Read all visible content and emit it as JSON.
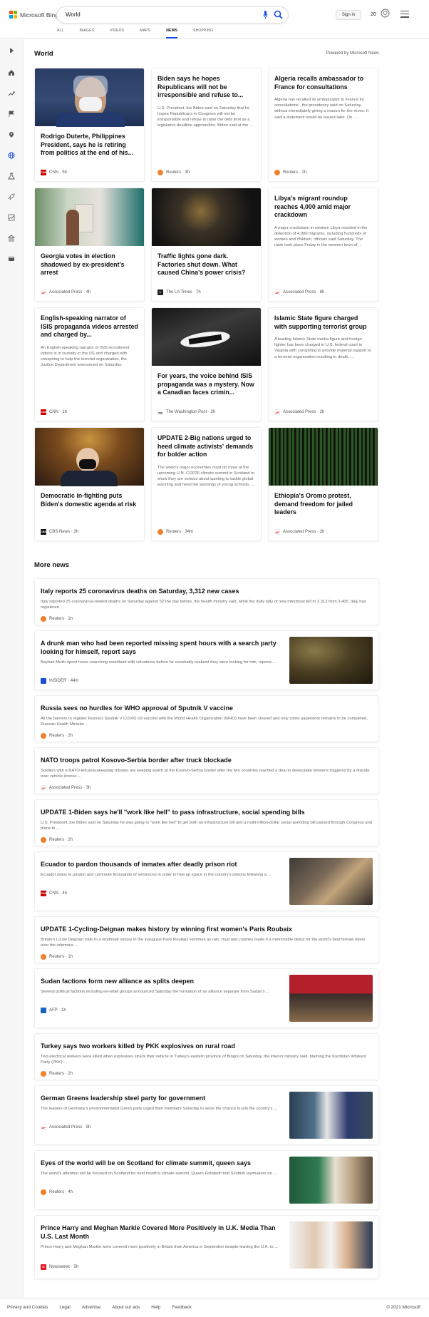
{
  "header": {
    "logo_text": "Microsoft Bing",
    "search_value": "World",
    "sign_in": "Sign in",
    "rewards_count": "20",
    "tabs": [
      "ALL",
      "IMAGES",
      "VIDEOS",
      "MAPS",
      "NEWS",
      "SHOPPING"
    ],
    "active_tab": "NEWS"
  },
  "world": {
    "title": "World",
    "powered_by": "Powered by Microsoft News",
    "cards": [
      {
        "title": "Rodrigo Duterte, Philippines President, says he is retiring from politics at the end of his...",
        "desc": "",
        "source": "CNN",
        "time": "5h"
      },
      {
        "title": "Biden says he hopes Republicans will not be irresponsible and refuse to...",
        "desc": "U.S. President Joe Biden said on Saturday that he hopes Republicans in Congress will not be irresponsible and refuse to raise the debt limit as a legislative deadline approaches. Biden said at the ...",
        "source": "Reuters",
        "time": "3h"
      },
      {
        "title": "Algeria recalls ambassador to France for consultations",
        "desc": "Algeria has recalled its ambassador to France for consultations , the presidency said on Saturday, without immediately giving a reason for the move. It said a statement would be issued later. On ...",
        "source": "Reuters",
        "time": "1h"
      },
      {
        "title": "Georgia votes in election shadowed by ex-president's arrest",
        "desc": "",
        "source": "Associated Press",
        "time": "4h"
      },
      {
        "title": "Traffic lights gone dark. Factories shut down. What caused China's power crisis?",
        "desc": "",
        "source": "The LA Times",
        "time": "7h"
      },
      {
        "title": "Libya's migrant roundup reaches 4,000 amid major crackdown",
        "desc": "A major crackdown in western Libya resulted in the detention of 4,000 migrants, including hundreds of women and children, officials said Saturday. The raids took place Friday in the western town of ...",
        "source": "Associated Press",
        "time": "6h"
      },
      {
        "title": "English-speaking narrator of ISIS propaganda videos arrested and charged by...",
        "desc": "An English-speaking narrator of ISIS recruitment videos is in custody in the US and charged with conspiring to help the terrorist organization, the Justice Department announced on Saturday.",
        "source": "CNN",
        "time": "1h"
      },
      {
        "title": "For years, the voice behind ISIS propaganda was a mystery. Now a Canadian faces crimin...",
        "desc": "",
        "source": "The Washington Post",
        "time": "2h"
      },
      {
        "title": "Islamic State figure charged with supporting terrorist group",
        "desc": "A leading Islamic State media figure and foreign fighter has been charged in U.S. federal court in Virginia with conspiring to provide material support to a terrorist organization resulting in death, ...",
        "source": "Associated Press",
        "time": "2h"
      },
      {
        "title": "Democratic in-fighting puts Biden's domestic agenda at risk",
        "desc": "",
        "source": "CBS News",
        "time": "3h"
      },
      {
        "title": "UPDATE 2-Big nations urged to heed climate activists' demands for bolder action",
        "desc": "The world's major economies must do more at the upcoming U.N. COP26 climate summit in Scotland to show they are serious about wanting to tackle global warming and heed the warnings of young activists, ...",
        "source": "Reuters",
        "time": "34m"
      },
      {
        "title": "Ethiopia's Oromo protest, demand freedom for jailed leaders",
        "desc": "",
        "source": "Associated Press",
        "time": "2h"
      }
    ]
  },
  "more_news": {
    "title": "More news",
    "items": [
      {
        "title": "Italy reports 25 coronavirus deaths on Saturday, 3,312 new cases",
        "desc": "Italy reported 25 coronavirus-related deaths on Saturday against 52 the day before, the health ministry said, while the daily tally of new infections fell to 3,312 from 3,405. Italy has registered ...",
        "source": "Reuters",
        "time": "1h"
      },
      {
        "title": "A drunk man who had been reported missing spent hours with a search party looking for himself, report says",
        "desc": "Beyhan Mutlu spent hours searching woodland with volunteers before he eventually realized they were looking for him, reports ...",
        "source": "INSIDER",
        "time": "44m"
      },
      {
        "title": "Russia sees no hurdles for WHO approval of Sputnik V vaccine",
        "desc": "All the barriers to register Russia's Sputnik V COVID-19 vaccine with the World Health Organization (WHO) have been cleared and only some paperwork remains to be completed, Russian Health Minister ...",
        "source": "Reuters",
        "time": "2h"
      },
      {
        "title": "NATO troops patrol Kosovo-Serbia border after truck blockade",
        "desc": "Soldiers with a NATO-led peacekeeping mission are keeping watch at the Kosovo-Serbia border after the two countries reached a deal to deescalate tensions triggered by a dispute over vehicle license ...",
        "source": "Associated Press",
        "time": "3h"
      },
      {
        "title": "UPDATE 1-Biden says he'll \"work like hell\" to pass infrastructure, social spending bills",
        "desc": "U.S. President Joe Biden said on Saturday he was going to \"work like hell\" to get both an infrastructure bill and a multi-trillion-dollar social spending bill passed through Congress and plans to ...",
        "source": "Reuters",
        "time": "2h"
      },
      {
        "title": "Ecuador to pardon thousands of inmates after deadly prison riot",
        "desc": "Ecuador plans to pardon and commute thousands of sentences in order to free up space in the country's prisons following a ...",
        "source": "CNN",
        "time": "4h"
      },
      {
        "title": "UPDATE 1-Cycling-Deignan makes history by winning first women's Paris Roubaix",
        "desc": "Britain's Lizzie Deignan rode to a landmark victory in the inaugural Paris Roubaix Femmes as rain, mud and crashes made it a memorable debut for the world's best female riders over the infamous ...",
        "source": "Reuters",
        "time": "1h"
      },
      {
        "title": "Sudan factions form new alliance as splits deepen",
        "desc": "Several political factions including ex-rebel groups announced Saturday the formation of an alliance separate from Sudan's ...",
        "source": "AFP",
        "time": "1h"
      },
      {
        "title": "Turkey says two workers killed by PKK explosives on rural road",
        "desc": "Two electrical workers were killed when explosives struck their vehicle in Turkey's eastern province of Bingol on Saturday, the interior ministry said, blaming the Kurdistan Workers' Party (PKK) ...",
        "source": "Reuters",
        "time": "2h"
      },
      {
        "title": "German Greens leadership steel party for government",
        "desc": "The leaders of Germany's environmentalist Green party urged their members Saturday to seize the chance to join the country's ...",
        "source": "Associated Press",
        "time": "5h"
      },
      {
        "title": "Eyes of the world will be on Scotland for climate summit, queen says",
        "desc": "The world's attention will be focused on Scotland for next month's climate summit, Queen Elizabeth told Scottish lawmakers on ...",
        "source": "Reuters",
        "time": "4h"
      },
      {
        "title": "Prince Harry and Meghan Markle Covered More Positively in U.K. Media Than U.S. Last Month",
        "desc": "Prince Harry and Meghan Markle were covered more positively in Britain than America in September despite leaving the U.K. to ...",
        "source": "Newsweek",
        "time": "5h"
      }
    ]
  },
  "footer": {
    "links": [
      "Privacy and Cookies",
      "Legal",
      "Advertise",
      "About our ads",
      "Help",
      "Feedback"
    ],
    "copyright": "© 2021 Microsoft"
  },
  "colors": {
    "accent": "#174ae4",
    "reuters": "#f0822d",
    "cnn": "#cc0000",
    "ap": "#e21b22"
  }
}
